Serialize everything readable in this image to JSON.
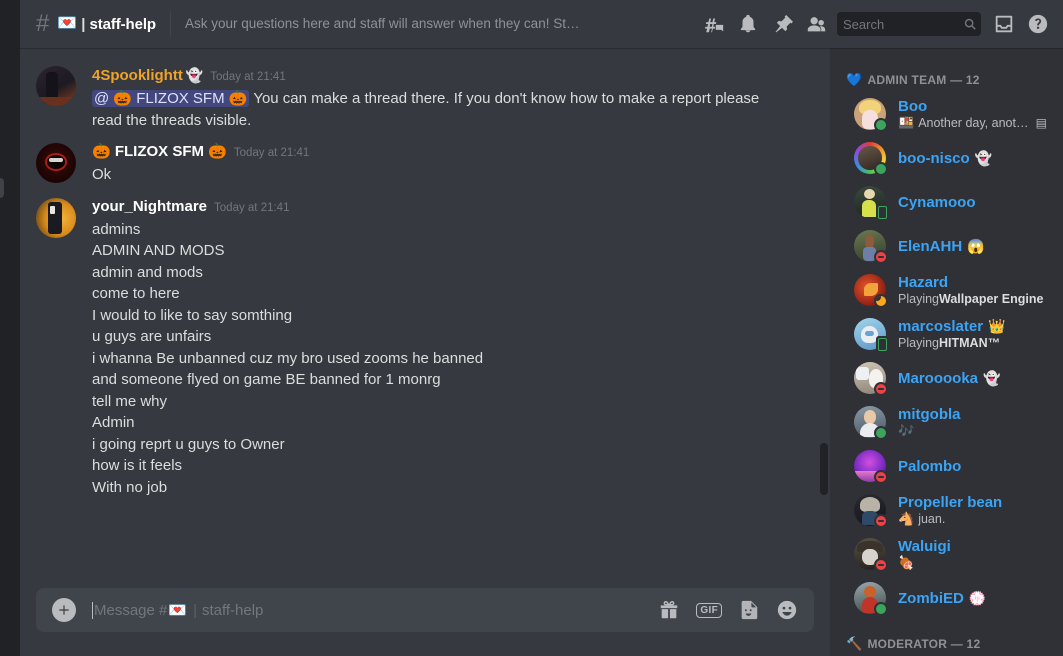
{
  "colors": {
    "app_bg": "#36393f",
    "sidebar_bg": "#2f3136",
    "rail_bg": "#202225",
    "composer_bg": "#40444b",
    "member_name": "#3ba4f5",
    "author_spook": "#f0a32a",
    "author_default": "#ffffff",
    "mention_bg": "#5865f2",
    "status_online": "#3ba55d",
    "status_dnd": "#ed4245",
    "status_idle": "#faa81a"
  },
  "header": {
    "hash_icon": "hash-icon",
    "channel_emoji": "💌",
    "channel_separator": "|",
    "channel_name": "staff-help",
    "topic": "Ask your questions here and staff will answer when they can! Staff are here...",
    "icons": [
      {
        "name": "threads-icon",
        "label": "Threads"
      },
      {
        "name": "notification-bell-icon",
        "label": "Notification Settings"
      },
      {
        "name": "pinned-messages-icon",
        "label": "Pinned Messages"
      },
      {
        "name": "member-list-icon",
        "label": "Member List"
      }
    ],
    "search": {
      "placeholder": "Search",
      "value": "",
      "icon": "search-icon"
    },
    "right_icons": [
      {
        "name": "inbox-icon",
        "label": "Inbox"
      },
      {
        "name": "help-icon",
        "label": "Help"
      }
    ]
  },
  "messages": [
    {
      "author": "4Spooklightt",
      "author_emoji": "👻",
      "author_color": "#f0a32a",
      "timestamp": "Today at 21:41",
      "avatar_class": "a-spook",
      "lines": [
        {
          "mention": "@ 🎃 FLIZOX SFM 🎃",
          "text": " You can make a thread there. If you don't know how to make a report please"
        },
        {
          "text": "read the threads visible."
        }
      ]
    },
    {
      "author": "🎃 FLIZOX SFM 🎃",
      "author_emoji": "",
      "author_color": "#ffffff",
      "timestamp": "Today at 21:41",
      "avatar_class": "a-flizox",
      "lines": [
        {
          "text": "Ok"
        }
      ]
    },
    {
      "author": "your_Nightmare",
      "author_emoji": "",
      "author_color": "#ffffff",
      "timestamp": "Today at 21:41",
      "avatar_class": "a-night",
      "lines": [
        {
          "text": "admins"
        },
        {
          "text": "ADMIN AND MODS"
        },
        {
          "text": "admin and mods"
        },
        {
          "text": "come to here"
        },
        {
          "text": "I would to like to say somthing"
        },
        {
          "text": "u guys are unfairs"
        },
        {
          "text": "i whanna Be unbanned cuz my bro used zooms he banned"
        },
        {
          "text": "and someone flyed on game BE banned for 1 monrg"
        },
        {
          "text": "tell me why"
        },
        {
          "text": "Admin"
        },
        {
          "text": "i going reprt u guys to Owner"
        },
        {
          "text": "how is it feels"
        },
        {
          "text": "With no job"
        }
      ]
    }
  ],
  "composer": {
    "add_icon": "plus-icon",
    "placeholder_prefix": "Message #",
    "placeholder_emoji": "💌",
    "placeholder_separator": "|",
    "placeholder_channel": "staff-help",
    "value": "",
    "icons": [
      {
        "name": "gift-icon",
        "label": "Gift"
      },
      {
        "name": "gif-icon",
        "label": "GIF"
      },
      {
        "name": "sticker-icon",
        "label": "Sticker"
      },
      {
        "name": "emoji-icon",
        "label": "Emoji"
      }
    ]
  },
  "member_list": {
    "groups": [
      {
        "emoji": "💙",
        "label": "ADMIN TEAM",
        "count": "12",
        "header_text": "ADMIN TEAM — 12",
        "members": [
          {
            "name": "Boo",
            "name_emoji": "",
            "status": "online",
            "avatar_class": "a-boo",
            "sub_emoji": "🍱",
            "sub_text": "Another day, another vi...",
            "sub_bold": "",
            "sub_badge": "▤"
          },
          {
            "name": "boo-nisco",
            "name_emoji": "👻",
            "status": "online",
            "avatar_class": "a-nisco",
            "sub_emoji": "",
            "sub_text": "",
            "sub_bold": "",
            "sub_badge": ""
          },
          {
            "name": "Cynamooo",
            "name_emoji": "",
            "status": "mobile",
            "avatar_class": "a-cyna",
            "sub_emoji": "",
            "sub_text": "",
            "sub_bold": "",
            "sub_badge": ""
          },
          {
            "name": "ElenAHH",
            "name_emoji": "😱",
            "status": "dnd",
            "avatar_class": "a-elen",
            "sub_emoji": "",
            "sub_text": "",
            "sub_bold": "",
            "sub_badge": ""
          },
          {
            "name": "Hazard",
            "name_emoji": "",
            "status": "idle",
            "avatar_class": "a-haz",
            "sub_emoji": "",
            "sub_text": "Playing ",
            "sub_bold": "Wallpaper Engine",
            "sub_badge": ""
          },
          {
            "name": "marcoslater",
            "name_emoji": "👑",
            "status": "mobile",
            "avatar_class": "a-marco",
            "sub_emoji": "",
            "sub_text": "Playing ",
            "sub_bold": "HITMAN™",
            "sub_badge": ""
          },
          {
            "name": "Marooooka",
            "name_emoji": "👻",
            "status": "dnd",
            "avatar_class": "a-maro",
            "sub_emoji": "",
            "sub_text": "",
            "sub_bold": "",
            "sub_badge": ""
          },
          {
            "name": "mitgobla",
            "name_emoji": "",
            "status": "online",
            "avatar_class": "a-mit",
            "sub_emoji": "🎶",
            "sub_text": "",
            "sub_bold": "",
            "sub_badge": ""
          },
          {
            "name": "Palombo",
            "name_emoji": "",
            "status": "dnd",
            "avatar_class": "a-pal",
            "sub_emoji": "",
            "sub_text": "",
            "sub_bold": "",
            "sub_badge": ""
          },
          {
            "name": "Propeller bean",
            "name_emoji": "",
            "status": "dnd",
            "avatar_class": "a-prop",
            "sub_emoji": "🐴",
            "sub_text": "juan.",
            "sub_bold": "",
            "sub_badge": ""
          },
          {
            "name": "Waluigi",
            "name_emoji": "",
            "status": "dnd",
            "avatar_class": "a-wal",
            "sub_emoji": "🍖",
            "sub_text": "",
            "sub_bold": "",
            "sub_badge": ""
          },
          {
            "name": "ZombiED",
            "name_emoji": "💮",
            "status": "online",
            "avatar_class": "a-zom",
            "sub_emoji": "",
            "sub_text": "",
            "sub_bold": "",
            "sub_badge": ""
          }
        ]
      },
      {
        "emoji": "🔨",
        "label": "MODERATOR",
        "count": "12",
        "header_text": "MODERATOR — 12",
        "members": []
      }
    ]
  }
}
